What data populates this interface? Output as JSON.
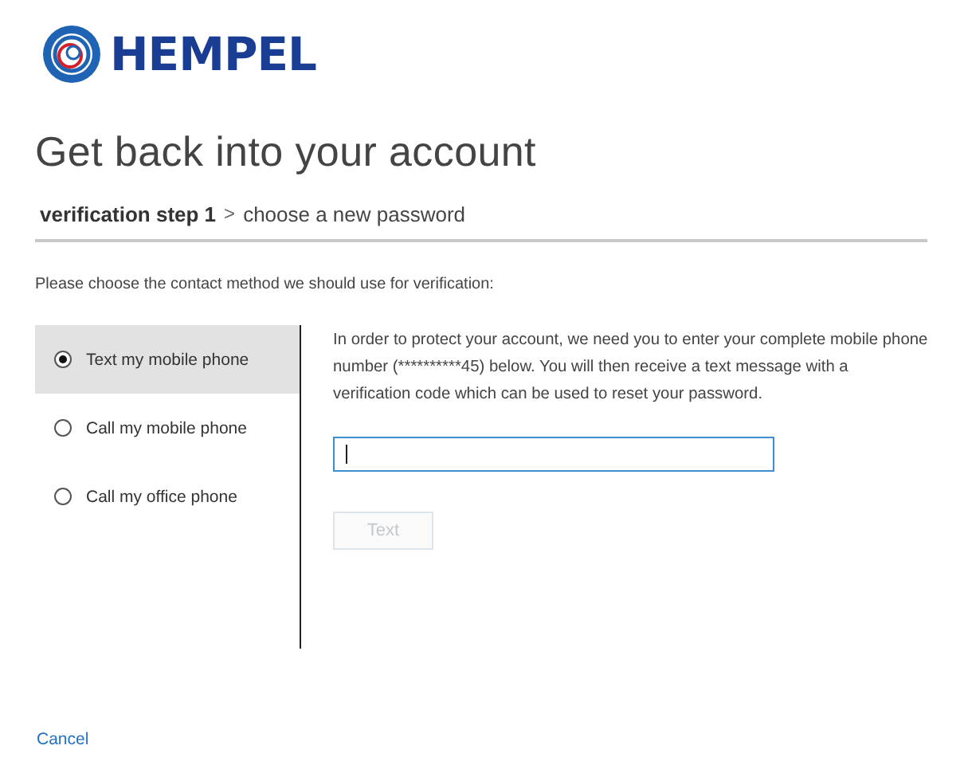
{
  "logo": {
    "text": "HEMPEL"
  },
  "title": "Get back into your account",
  "breadcrumb": [
    {
      "label": "verification step 1",
      "current": true
    },
    {
      "label": ">",
      "kind": "separator"
    },
    {
      "label": "choose a new password",
      "current": false
    }
  ],
  "prompt": "Please choose the contact method we should use for verification:",
  "methods": [
    {
      "label": "Text my mobile phone",
      "selected": true
    },
    {
      "label": "Call my mobile phone",
      "selected": false
    },
    {
      "label": "Call my office phone",
      "selected": false
    }
  ],
  "description": "In order to protect your account, we need you to enter your complete mobile phone number (**********45) below. You will then receive a text message with a verification code which can be used to reset your password.",
  "phone_field": {
    "focused": true
  },
  "submit_button": {
    "label": "Text",
    "disabled": true
  },
  "cancel": "Cancel"
}
